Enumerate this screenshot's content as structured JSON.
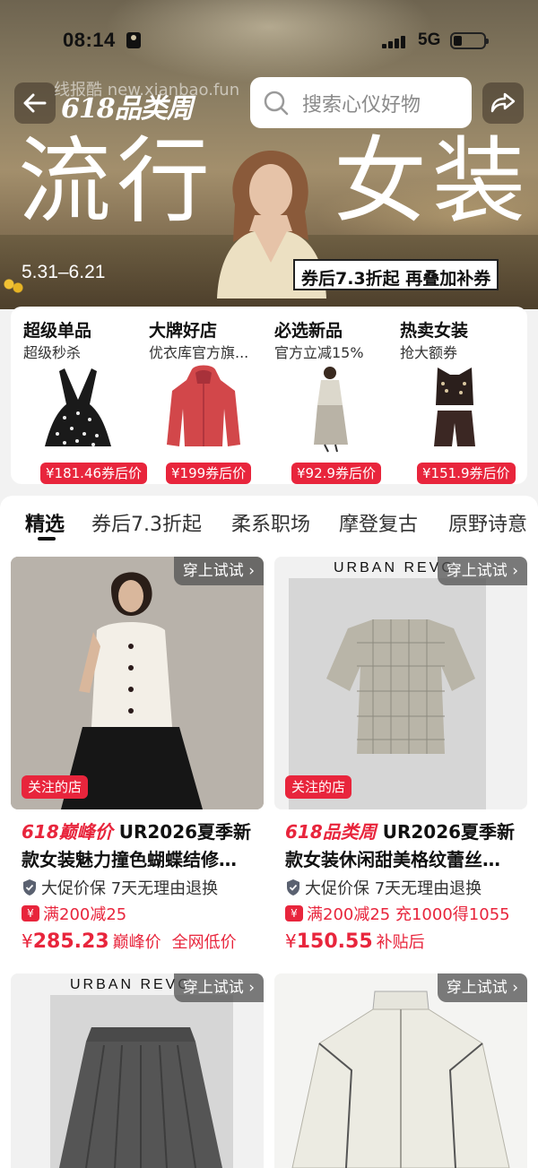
{
  "status_bar": {
    "time": "08:14",
    "network": "5G"
  },
  "header": {
    "campaign_logo_num": "618",
    "campaign_logo_text": "品类周",
    "watermark": "线报酷 new.xianbao.fun",
    "search_placeholder": "搜索心仪好物"
  },
  "hero": {
    "headline_left": "流行",
    "headline_right": "女装",
    "date_range": "5.31–6.21",
    "promo": "券后7.3折起 再叠加补券"
  },
  "categories": [
    {
      "title": "超级单品",
      "subtitle": "超级秒杀",
      "price": "¥181.46券后价"
    },
    {
      "title": "大牌好店",
      "subtitle": "优衣库官方旗...",
      "price": "¥199券后价"
    },
    {
      "title": "必选新品",
      "subtitle": "官方立减15%",
      "price": "¥92.9券后价"
    },
    {
      "title": "热卖女装",
      "subtitle": "抢大额券",
      "price": "¥151.9券后价"
    }
  ],
  "tabs": [
    "精选",
    "券后7.3折起",
    "柔系职场",
    "摩登复古",
    "原野诗意"
  ],
  "products": [
    {
      "tryon": "穿上试试 ›",
      "followed": "关注的店",
      "tag": "618巅峰价",
      "title": "UR2026夏季新款女装魅力撞色蝴蝶结修…",
      "guarantee": "大促价保  7天无理由退换",
      "coupon": "满200减25",
      "price_symbol": "¥",
      "price_int": "285.23",
      "price_note": "巅峰价",
      "price_note2": "全网低价"
    },
    {
      "tryon": "穿上试试 ›",
      "followed": "关注的店",
      "brand": "URBAN REVO",
      "tag": "618品类周",
      "title": "UR2026夏季新款女装休闲甜美格纹蕾丝…",
      "guarantee": "大促价保  7天无理由退换",
      "coupon": "满200减25  充1000得1055",
      "price_symbol": "¥",
      "price_int": "150.55",
      "price_note": "补贴后",
      "price_note2": ""
    },
    {
      "tryon": "穿上试试 ›",
      "brand": "URBAN REVO"
    },
    {
      "tryon": "穿上试试 ›"
    }
  ],
  "colors": {
    "accent": "#e8253c",
    "hero": "#8a7d62"
  }
}
